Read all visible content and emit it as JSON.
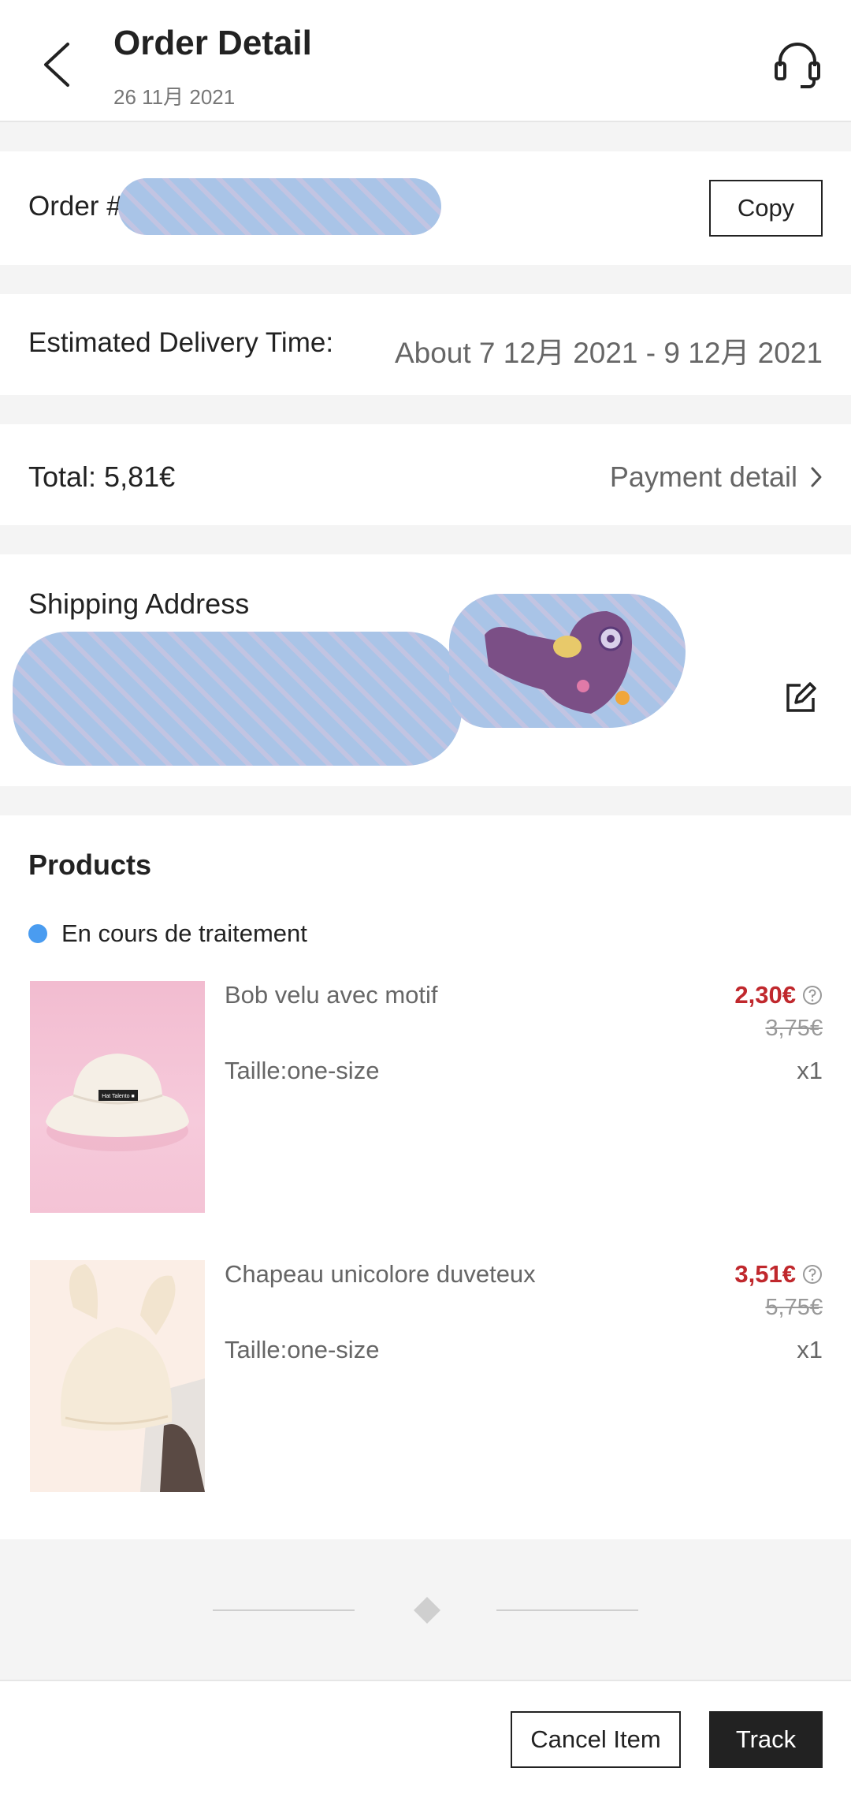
{
  "header": {
    "title": "Order Detail",
    "date": "26 11月 2021",
    "back_icon": "chevron-left-icon",
    "support_icon": "headset-icon"
  },
  "order": {
    "label": "Order #",
    "copy_label": "Copy"
  },
  "delivery": {
    "label": "Estimated Delivery Time:",
    "value": "About 7 12月 2021 - 9 12月 2021"
  },
  "payment": {
    "total": "Total: 5,81€",
    "detail_link": "Payment detail",
    "chevron_icon": "chevron-right-icon"
  },
  "shipping": {
    "label": "Shipping Address",
    "edit_icon": "edit-icon"
  },
  "products": {
    "title": "Products",
    "status": "En cours de traitement",
    "status_color": "#4a9cf0",
    "items": [
      {
        "name": "Bob velu avec motif",
        "size": "Taille:one-size",
        "price": "2,30€",
        "original_price": "3,75€",
        "quantity": "x1",
        "hat_label": "Hat Talento ■"
      },
      {
        "name": "Chapeau unicolore duveteux",
        "size": "Taille:one-size",
        "price": "3,51€",
        "original_price": "5,75€",
        "quantity": "x1"
      }
    ]
  },
  "actions": {
    "cancel_label": "Cancel Item",
    "track_label": "Track"
  },
  "colors": {
    "sale_price": "#c0282d",
    "redaction": "#a9c4e7"
  }
}
